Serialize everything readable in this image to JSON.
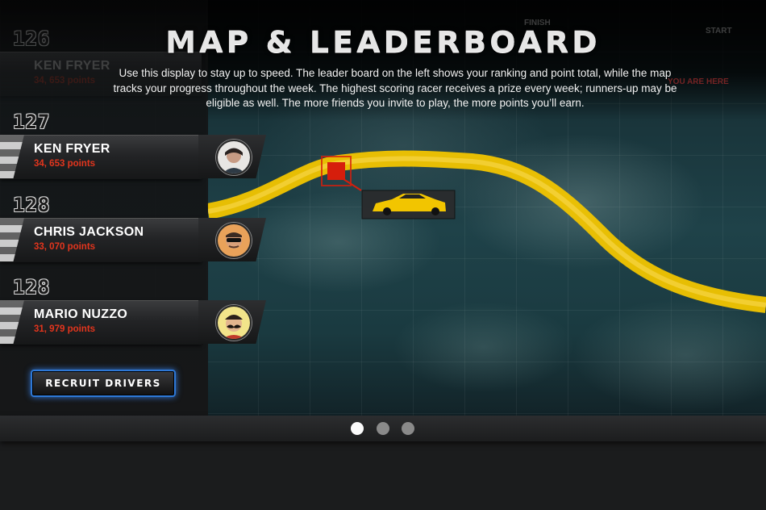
{
  "header": {
    "title": "MAP & LEADERBOARD",
    "intro": "Use this display to stay up to speed. The leader board on the left shows your ranking and point total, while the map tracks your progress throughout the week. The highest scoring racer receives a prize every week; runners-up may be eligible as well. The more friends you invite to play, the more points you’ll earn."
  },
  "map": {
    "finish_label": "FINISH",
    "start_label": "START",
    "you_are_here_label": "YOU ARE HERE",
    "route_color": "#f2c500",
    "marker_color": "#d61e0c"
  },
  "leaderboard": {
    "entries": [
      {
        "rank": "126",
        "name": "KEN FRYER",
        "points": "34, 653 points"
      },
      {
        "rank": "127",
        "name": "KEN FRYER",
        "points": "34, 653 points"
      },
      {
        "rank": "128",
        "name": "CHRIS JACKSON",
        "points": "33, 070 points"
      },
      {
        "rank": "128",
        "name": "MARIO NUZZO",
        "points": "31, 979 points"
      }
    ],
    "recruit_label": "RECRUIT DRIVERS"
  },
  "pager": {
    "pages": 3,
    "current": 1
  },
  "colors": {
    "accent_blue": "#2e78d6",
    "points_red": "#e3351d"
  }
}
